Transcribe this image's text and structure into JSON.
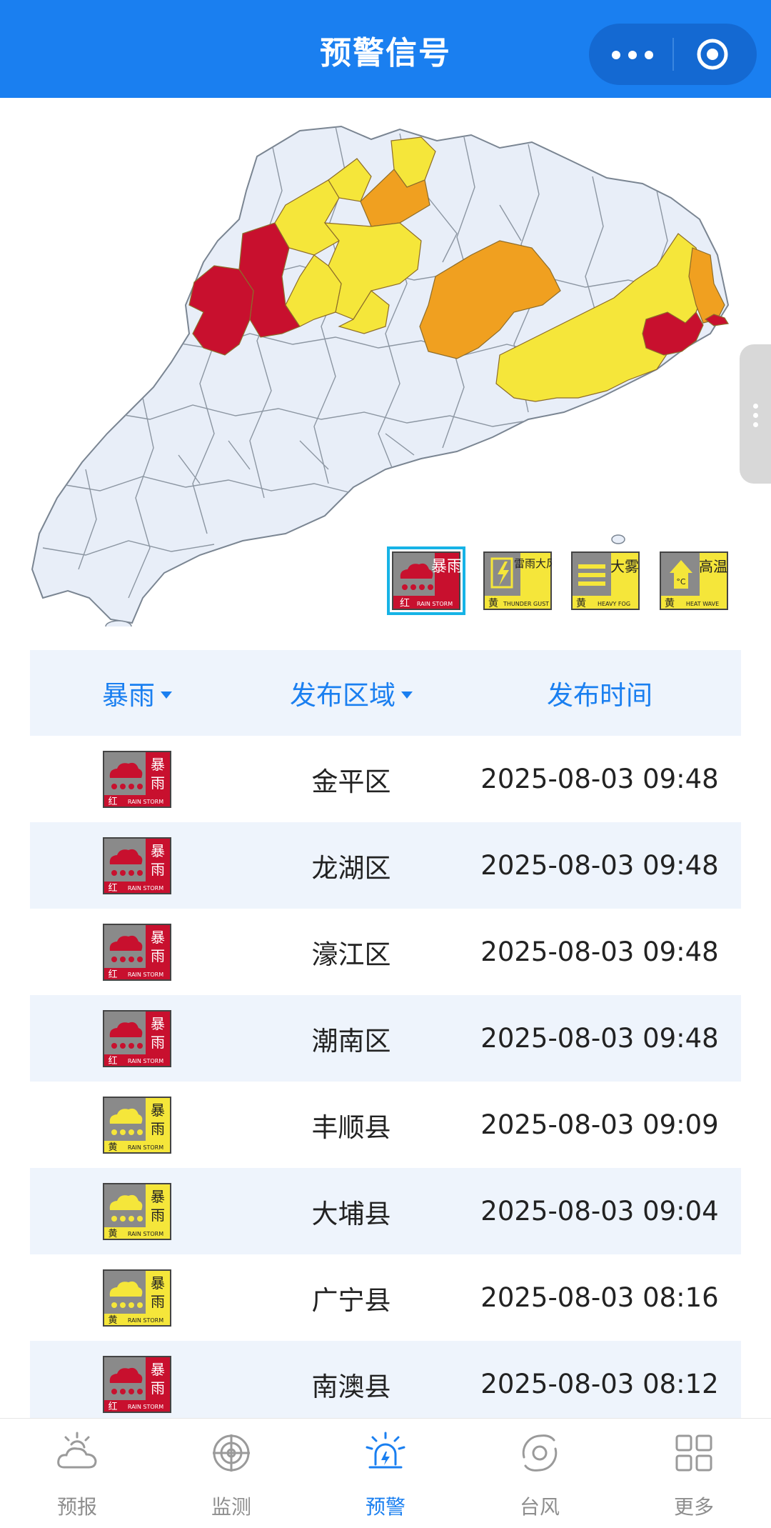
{
  "header": {
    "title": "预警信号"
  },
  "colors": {
    "accent": "#1a7ff0",
    "red": "#c8102e",
    "orange": "#f0a020",
    "yellow": "#f5e63a",
    "base": "#e8eef8"
  },
  "legend": [
    {
      "icon": "rainstorm-red-signal-icon",
      "main": "暴雨",
      "level": "红",
      "english": "RAIN STORM",
      "selected": true
    },
    {
      "icon": "thunder-gust-yellow-signal-icon",
      "main": "雷雨大风",
      "level": "黄",
      "english": "THUNDER GUST",
      "selected": false
    },
    {
      "icon": "heavy-fog-yellow-signal-icon",
      "main": "大雾",
      "level": "黄",
      "english": "HEAVY FOG",
      "selected": false
    },
    {
      "icon": "heat-wave-yellow-signal-icon",
      "main": "高温",
      "level": "黄",
      "english": "HEAT WAVE",
      "selected": false
    }
  ],
  "table": {
    "headers": {
      "type": "暴雨",
      "area": "发布区域",
      "time": "发布时间"
    },
    "rows": [
      {
        "level": "red",
        "level_text": "红",
        "area": "金平区",
        "time": "2025-08-03 09:48"
      },
      {
        "level": "red",
        "level_text": "红",
        "area": "龙湖区",
        "time": "2025-08-03 09:48"
      },
      {
        "level": "red",
        "level_text": "红",
        "area": "濠江区",
        "time": "2025-08-03 09:48"
      },
      {
        "level": "red",
        "level_text": "红",
        "area": "潮南区",
        "time": "2025-08-03 09:48"
      },
      {
        "level": "yellow",
        "level_text": "黄",
        "area": "丰顺县",
        "time": "2025-08-03 09:09"
      },
      {
        "level": "yellow",
        "level_text": "黄",
        "area": "大埔县",
        "time": "2025-08-03 09:04"
      },
      {
        "level": "yellow",
        "level_text": "黄",
        "area": "广宁县",
        "time": "2025-08-03 08:16"
      },
      {
        "level": "red",
        "level_text": "红",
        "area": "南澳县",
        "time": "2025-08-03 08:12"
      }
    ]
  },
  "badge": {
    "main_top": "暴",
    "main_bottom": "雨",
    "english": "RAIN STORM"
  },
  "nav": [
    {
      "label": "预报",
      "icon": "forecast-weather-icon",
      "active": false
    },
    {
      "label": "监测",
      "icon": "radar-monitor-icon",
      "active": false
    },
    {
      "label": "预警",
      "icon": "warning-siren-icon",
      "active": true
    },
    {
      "label": "台风",
      "icon": "typhoon-icon",
      "active": false
    },
    {
      "label": "更多",
      "icon": "grid-more-icon",
      "active": false
    }
  ]
}
